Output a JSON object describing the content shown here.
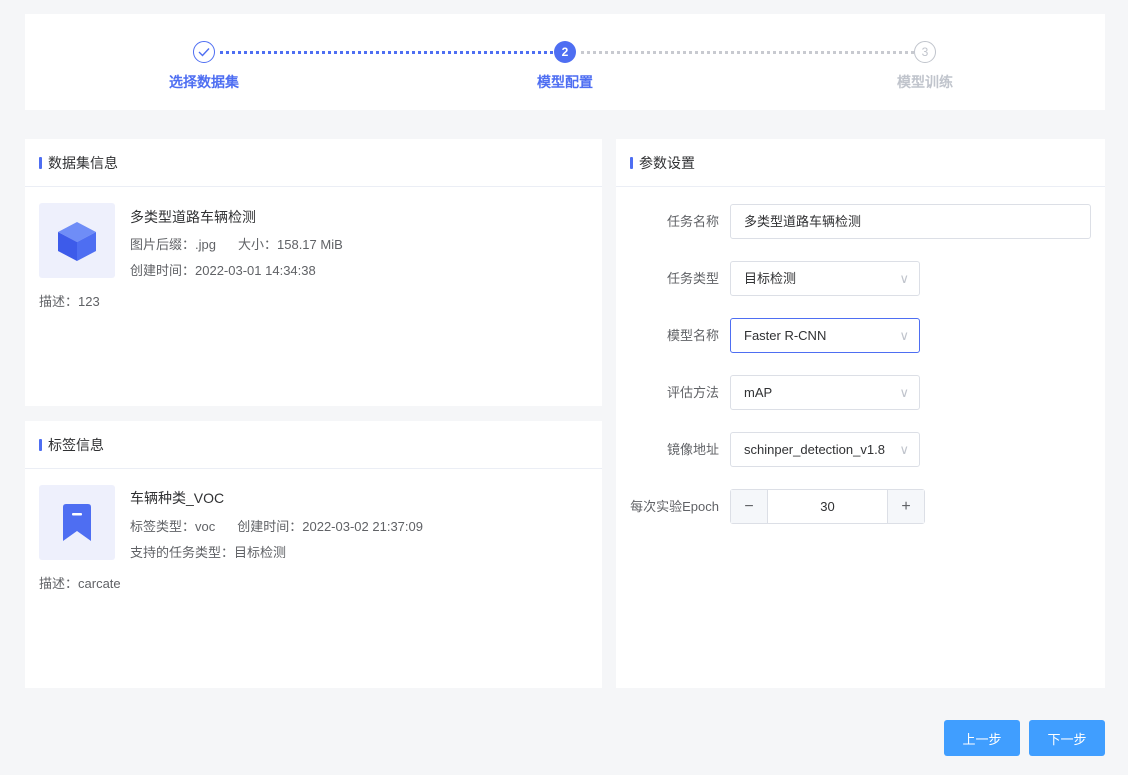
{
  "steps": [
    {
      "label": "选择数据集",
      "status": "done",
      "icon": "check-icon"
    },
    {
      "label": "模型配置",
      "status": "active",
      "number": "2"
    },
    {
      "label": "模型训练",
      "status": "todo",
      "number": "3"
    }
  ],
  "dataset": {
    "section_title": "数据集信息",
    "icon": "cube-icon",
    "name": "多类型道路车辆检测",
    "suffix_label": "图片后缀：",
    "suffix_value": ".jpg",
    "size_label": "大小：",
    "size_value": "158.17 MiB",
    "created_label": "创建时间：",
    "created_value": "2022-03-01 14:34:38",
    "desc_label": "描述：",
    "desc_value": "123"
  },
  "label_info": {
    "section_title": "标签信息",
    "icon": "bookmark-icon",
    "name": "车辆种类_VOC",
    "type_label": "标签类型：",
    "type_value": "voc",
    "created_label": "创建时间：",
    "created_value": "2022-03-02 21:37:09",
    "task_label": "支持的任务类型：",
    "task_value": "目标检测",
    "desc_label": "描述：",
    "desc_value": "carcate"
  },
  "params": {
    "section_title": "参数设置",
    "task_name_label": "任务名称",
    "task_name_value": "多类型道路车辆检测",
    "task_type_label": "任务类型",
    "task_type_value": "目标检测",
    "model_name_label": "模型名称",
    "model_name_value": "Faster R-CNN",
    "eval_label": "评估方法",
    "eval_value": "mAP",
    "image_label": "镜像地址",
    "image_value": "schinper_detection_v1.8",
    "epoch_label": "每次实验Epoch",
    "epoch_value": "30",
    "minus": "−",
    "plus": "+",
    "chevron": "∨"
  },
  "footer": {
    "prev_label": "上一步",
    "next_label": "下一步"
  },
  "colors": {
    "accent": "#4e6ef2",
    "button": "#409eff",
    "thumb_bg": "#eef0fc"
  }
}
